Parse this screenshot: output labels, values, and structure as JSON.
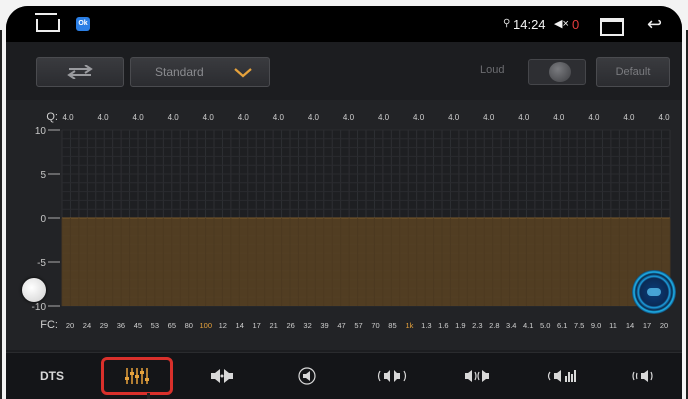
{
  "status_bar": {
    "time": "14:24",
    "volume_value": "0",
    "app_badge": "Ok"
  },
  "toolbar": {
    "preset": "Standard",
    "loud_label": "Loud",
    "default_label": "Default"
  },
  "eq": {
    "q_label": "Q:",
    "fc_label": "FC:",
    "y_ticks": [
      "10",
      "5",
      "0",
      "-5",
      "-10"
    ],
    "q_values": [
      "4.0",
      "4.0",
      "4.0",
      "4.0",
      "4.0",
      "4.0",
      "4.0",
      "4.0",
      "4.0",
      "4.0",
      "4.0",
      "4.0",
      "4.0",
      "4.0",
      "4.0",
      "4.0",
      "4.0",
      "4.0"
    ],
    "fc_values": [
      "20",
      "24",
      "29",
      "36",
      "45",
      "53",
      "65",
      "80",
      "100",
      "12",
      "14",
      "17",
      "21",
      "26",
      "32",
      "39",
      "47",
      "57",
      "70",
      "85",
      "1k",
      "1.3",
      "1.6",
      "1.9",
      "2.3",
      "2.8",
      "3.4",
      "4.1",
      "5.0",
      "6.1",
      "7.5",
      "9.0",
      "11",
      "14",
      "17",
      "20"
    ],
    "fc_highlight": [
      "100",
      "1k"
    ],
    "band_gains_db": [
      0,
      0,
      0,
      0,
      0,
      0,
      0,
      0,
      0,
      0,
      0,
      0,
      0,
      0,
      0,
      0,
      0,
      0,
      0,
      0,
      0,
      0,
      0,
      0,
      0,
      0,
      0,
      0,
      0,
      0,
      0,
      0,
      0,
      0,
      0,
      0
    ],
    "highlight_color": "#e6a23c",
    "fill_color": "#5a4322"
  },
  "tabs": [
    {
      "label": "DTS",
      "icon": "dts-text",
      "active": false
    },
    {
      "label": "",
      "icon": "equalizer-sliders-icon",
      "active": true
    },
    {
      "label": "",
      "icon": "speaker-balance-icon",
      "active": false
    },
    {
      "label": "",
      "icon": "surround-speaker-icon",
      "active": false
    },
    {
      "label": "",
      "icon": "sound-field-icon",
      "active": false
    },
    {
      "label": "",
      "icon": "stereo-width-icon",
      "active": false
    },
    {
      "label": "",
      "icon": "subwoofer-icon",
      "active": false
    },
    {
      "label": "",
      "icon": "speaker-delay-icon",
      "active": false
    }
  ],
  "colors": {
    "accent_red": "#d9302b",
    "status_red": "#e43c3c",
    "dropdown_orange": "#e6a23c"
  }
}
